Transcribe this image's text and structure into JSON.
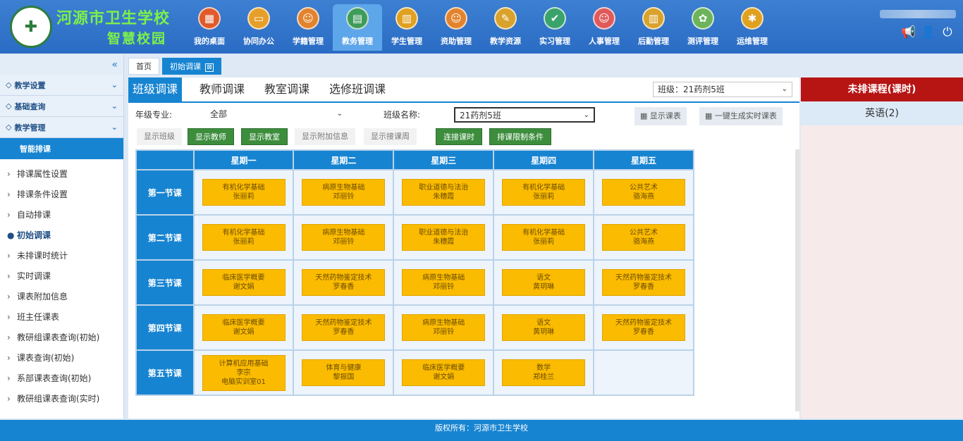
{
  "header": {
    "school_name": "河源市卫生学校",
    "school_sub": "智慧校园",
    "logo_glyph": "✚",
    "nav": [
      {
        "label": "我的桌面",
        "icon": "desktop-icon",
        "color": "#e05a2a",
        "glyph": "▦"
      },
      {
        "label": "协同办公",
        "icon": "office-icon",
        "color": "#e59f2a",
        "glyph": "▭"
      },
      {
        "label": "学籍管理",
        "icon": "student-record-icon",
        "color": "#e3832e",
        "glyph": "☺"
      },
      {
        "label": "教务管理",
        "icon": "academic-icon",
        "color": "#3f9b5a",
        "glyph": "▤"
      },
      {
        "label": "学生管理",
        "icon": "student-icon",
        "color": "#e0a020",
        "glyph": "▥"
      },
      {
        "label": "资助管理",
        "icon": "aid-icon",
        "color": "#e3832e",
        "glyph": "☺"
      },
      {
        "label": "教学资源",
        "icon": "resource-icon",
        "color": "#d9a22c",
        "glyph": "✎"
      },
      {
        "label": "实习管理",
        "icon": "internship-icon",
        "color": "#3aa36b",
        "glyph": "✔"
      },
      {
        "label": "人事管理",
        "icon": "hr-icon",
        "color": "#e05a5a",
        "glyph": "☺"
      },
      {
        "label": "后勤管理",
        "icon": "logistics-icon",
        "color": "#d9a22c",
        "glyph": "▥"
      },
      {
        "label": "测评管理",
        "icon": "evaluation-icon",
        "color": "#6db35a",
        "glyph": "✿"
      },
      {
        "label": "运维管理",
        "icon": "ops-icon",
        "color": "#e0a020",
        "glyph": "✱"
      }
    ],
    "active_nav": 3
  },
  "sidebar": {
    "collapse": "«",
    "groups": [
      "教学设置",
      "基础查询",
      "教学管理"
    ],
    "active": "智能排课",
    "items": [
      "排课属性设置",
      "排课条件设置",
      "自动排课",
      "初始调课",
      "未排课时统计",
      "实时调课",
      "课表附加信息",
      "班主任课表",
      "教研组课表查询(初始)",
      "课表查询(初始)",
      "系部课表查询(初始)",
      "教研组课表查询(实时)"
    ],
    "current_index": 3
  },
  "tabs": [
    {
      "label": "首页"
    },
    {
      "label": "初始调课",
      "close": "⊠"
    }
  ],
  "subtabs": [
    "班级调课",
    "教师调课",
    "教室调课",
    "选修班调课"
  ],
  "class_select": "班级：21药剂5班",
  "filters": {
    "major_label": "年级专业:",
    "major_value": "全部",
    "class_label": "班级名称:",
    "class_value": "21药剂5班"
  },
  "buttons": {
    "show_schedule": "显示课表",
    "gen_realtime": "一键生成实时课表",
    "show_class": "显示班级",
    "show_teacher": "显示教师",
    "show_room": "显示教室",
    "show_extra": "显示附加信息",
    "show_week": "显示接课周",
    "continuous": "连接课时",
    "constraints": "排课限制条件"
  },
  "weekdays": [
    "星期一",
    "星期二",
    "星期三",
    "星期四",
    "星期五"
  ],
  "periods": [
    "第一节课",
    "第二节课",
    "第三节课",
    "第四节课",
    "第五节课"
  ],
  "schedule": [
    [
      [
        "有机化学基础",
        "张丽莉"
      ],
      [
        "病原生物基础",
        "邓丽铃"
      ],
      [
        "职业道德与法治",
        "朱穗霞"
      ],
      [
        "有机化学基础",
        "张丽莉"
      ],
      [
        "公共艺术",
        "骆海燕"
      ]
    ],
    [
      [
        "有机化学基础",
        "张丽莉"
      ],
      [
        "病原生物基础",
        "邓丽铃"
      ],
      [
        "职业道德与法治",
        "朱穗霞"
      ],
      [
        "有机化学基础",
        "张丽莉"
      ],
      [
        "公共艺术",
        "骆海燕"
      ]
    ],
    [
      [
        "临床医学概要",
        "谢文娟"
      ],
      [
        "天然药物鉴定技术",
        "罗春香"
      ],
      [
        "病原生物基础",
        "邓丽铃"
      ],
      [
        "语文",
        "黄玥琳"
      ],
      [
        "天然药物鉴定技术",
        "罗春香"
      ]
    ],
    [
      [
        "临床医学概要",
        "谢文娟"
      ],
      [
        "天然药物鉴定技术",
        "罗春香"
      ],
      [
        "病原生物基础",
        "邓丽铃"
      ],
      [
        "语文",
        "黄玥琳"
      ],
      [
        "天然药物鉴定技术",
        "罗春香"
      ]
    ],
    [
      [
        "计算机应用基础",
        "李宗",
        "电脑实训室01"
      ],
      [
        "体育与健康",
        "黎振国"
      ],
      [
        "临床医学概要",
        "谢文娟"
      ],
      [
        "数学",
        "郑桂兰"
      ],
      []
    ]
  ],
  "unscheduled": {
    "title": "未排课程(课时)",
    "items": [
      "英语(2)"
    ]
  },
  "footer": "版权所有：河源市卫生学校"
}
